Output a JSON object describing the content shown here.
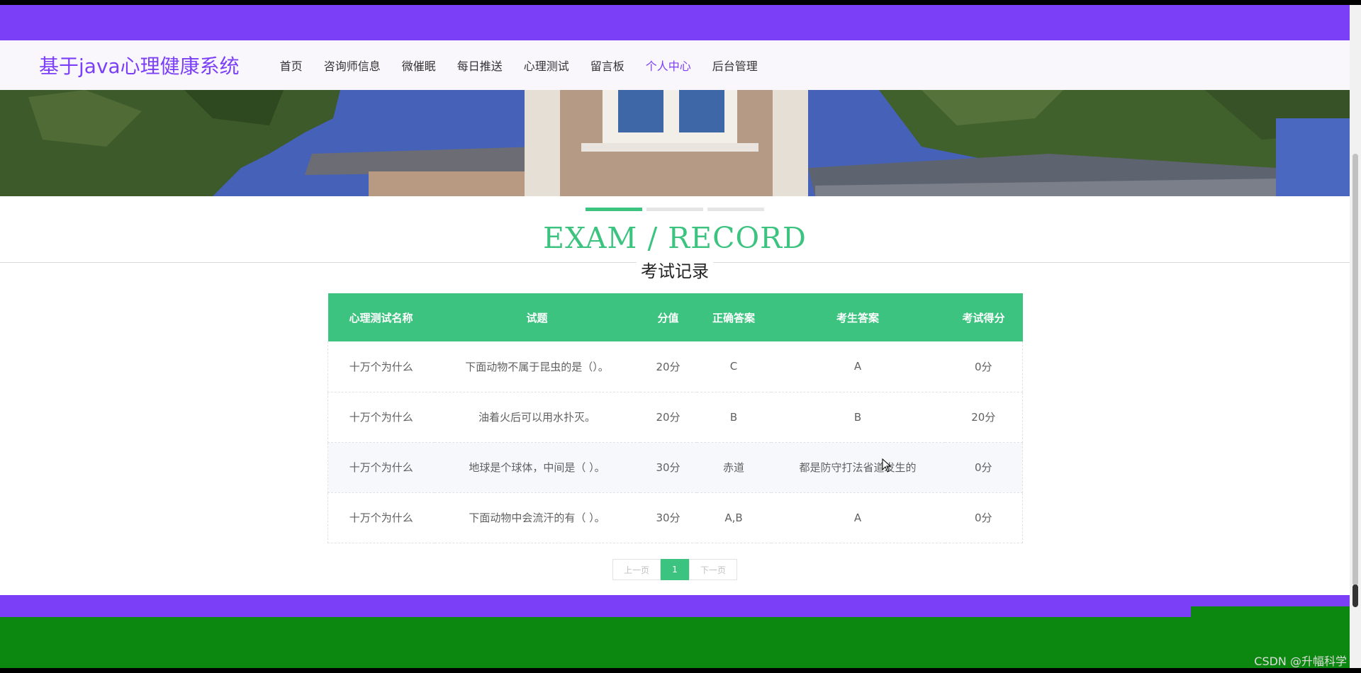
{
  "header": {
    "site_title": "基于java心理健康系统",
    "nav": [
      {
        "label": "首页",
        "active": false
      },
      {
        "label": "咨询师信息",
        "active": false
      },
      {
        "label": "微催眠",
        "active": false
      },
      {
        "label": "每日推送",
        "active": false
      },
      {
        "label": "心理测试",
        "active": false
      },
      {
        "label": "留言板",
        "active": false
      },
      {
        "label": "个人中心",
        "active": true
      },
      {
        "label": "后台管理",
        "active": false
      }
    ]
  },
  "section": {
    "title_en": "EXAM / RECORD",
    "title_cn": "考试记录"
  },
  "table": {
    "columns": [
      "心理测试名称",
      "试题",
      "分值",
      "正确答案",
      "考生答案",
      "考试得分"
    ],
    "rows": [
      [
        "十万个为什么",
        "下面动物不属于昆虫的是（）。",
        "20分",
        "C",
        "A",
        "0分"
      ],
      [
        "十万个为什么",
        "油着火后可以用水扑灭。",
        "20分",
        "B",
        "B",
        "20分"
      ],
      [
        "十万个为什么",
        "地球是个球体，中间是（ ）。",
        "30分",
        "赤道",
        "都是防守打法省道发生的",
        "0分"
      ],
      [
        "十万个为什么",
        "下面动物中会流汗的有（ ）。",
        "30分",
        "A,B",
        "A",
        "0分"
      ]
    ]
  },
  "pagination": {
    "prev": "上一页",
    "current": "1",
    "next": "下一页"
  },
  "watermark": "CSDN @升幅科学",
  "colors": {
    "brand_purple": "#7b3ff7",
    "accent_green": "#3cc37f",
    "footer_green": "#0c8810"
  }
}
